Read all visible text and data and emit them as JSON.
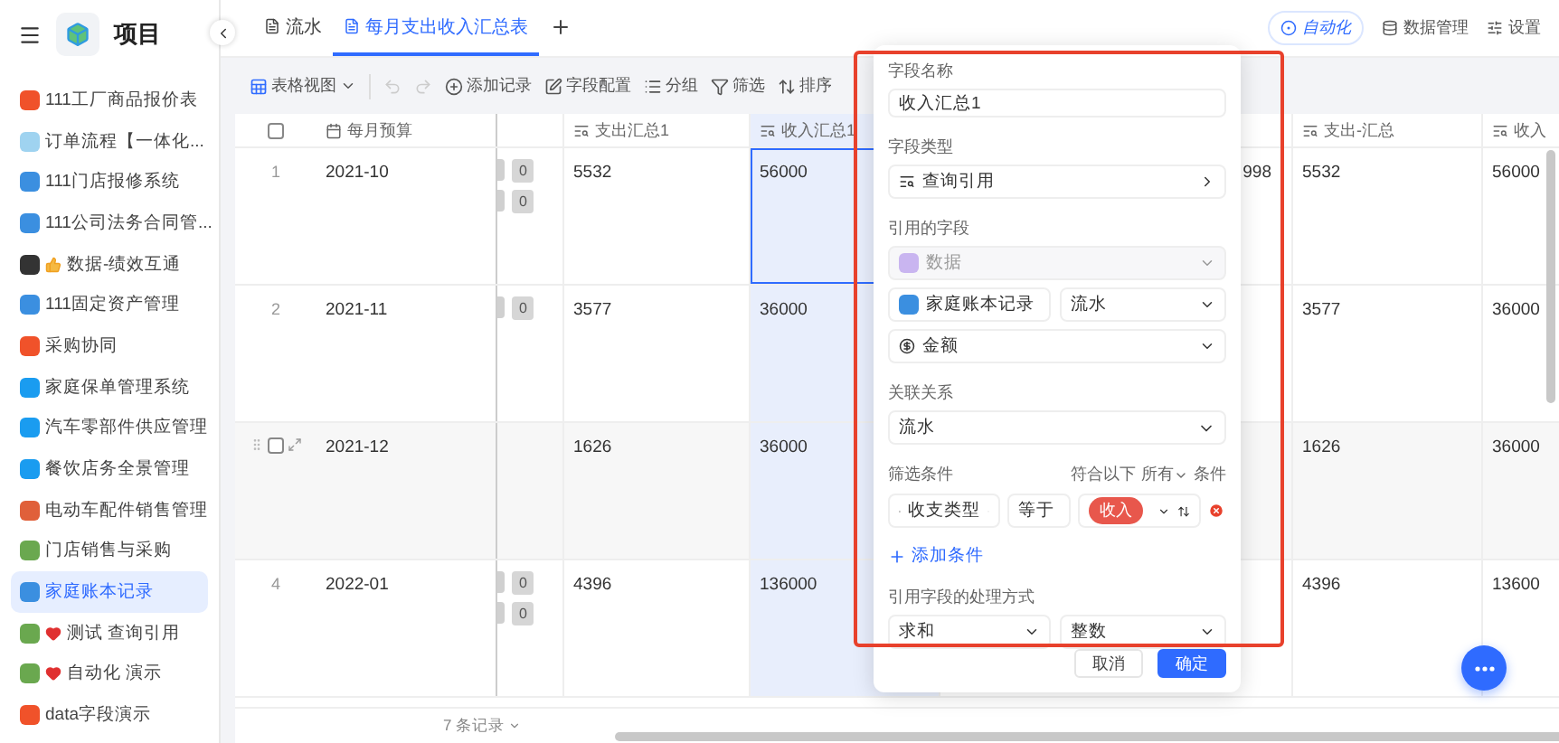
{
  "sidebar": {
    "title": "项目",
    "items": [
      {
        "label": "111工厂商品报价表",
        "color": "#f0522a",
        "selected": false
      },
      {
        "label": "订单流程【一体化...",
        "color": "#9fd3f0",
        "selected": false
      },
      {
        "label": "111门店报修系统",
        "color": "#3b8fe0",
        "selected": false
      },
      {
        "label": "111公司法务合同管...",
        "color": "#3b8fe0",
        "selected": false
      },
      {
        "label": "数据-绩效互通",
        "color": "#333333",
        "kind": "thumb",
        "selected": false
      },
      {
        "label": "111固定资产管理",
        "color": "#3b8fe0",
        "selected": false
      },
      {
        "label": "采购协同",
        "color": "#f0522a",
        "selected": false
      },
      {
        "label": "家庭保单管理系统",
        "color": "#1a9cf0",
        "selected": false
      },
      {
        "label": "汽车零部件供应管理",
        "color": "#1a9cf0",
        "selected": false
      },
      {
        "label": "餐饮店务全景管理",
        "color": "#1a9cf0",
        "selected": false
      },
      {
        "label": "电动车配件销售管理",
        "color": "#e0603a",
        "selected": false
      },
      {
        "label": "门店销售与采购",
        "color": "#6aa84f",
        "selected": false
      },
      {
        "label": "家庭账本记录",
        "color": "#3b8fe0",
        "selected": true
      },
      {
        "label": "测试 查询引用",
        "color": "#6aa84f",
        "kind": "heart",
        "selected": false
      },
      {
        "label": "自动化 演示",
        "color": "#6aa84f",
        "kind": "heart",
        "selected": false
      },
      {
        "label": "data字段演示",
        "color": "#f0522a",
        "selected": false
      }
    ]
  },
  "tabs": [
    {
      "label": "流水",
      "selected": false
    },
    {
      "label": "每月支出收入汇总表",
      "selected": true
    }
  ],
  "top_actions": {
    "automation": "自动化",
    "data_manage": "数据管理",
    "settings": "设置"
  },
  "toolbar": {
    "view": "表格视图",
    "items": [
      "添加记录",
      "字段配置",
      "分组",
      "筛选",
      "排序"
    ]
  },
  "table": {
    "columns": [
      {
        "label": "每月预算",
        "kind": "date",
        "selected": false
      },
      {
        "label": "支出汇总1",
        "kind": "lookup",
        "selected": false
      },
      {
        "label": "收入汇总1",
        "kind": "lookup",
        "selected": true
      },
      {
        "label": "支出-汇总",
        "kind": "lookup",
        "selected": false
      },
      {
        "label": "收入",
        "kind": "lookup",
        "selected": false
      }
    ],
    "rows": [
      {
        "number": "1",
        "hovered": false,
        "active": true,
        "month": "2021-10",
        "tags": [
          "0",
          "0"
        ],
        "expense": "5532",
        "income": "56000",
        "covered_value": "998",
        "expense_2": "5532",
        "income_2": "56000"
      },
      {
        "number": "2",
        "hovered": false,
        "active": false,
        "month": "2021-11",
        "tags": [
          "0"
        ],
        "expense": "3577",
        "income": "36000",
        "expense_2": "3577",
        "income_2": "36000"
      },
      {
        "hovered": true,
        "checked": false,
        "active": false,
        "month": "2021-12",
        "tags": [],
        "expense": "1626",
        "income": "36000",
        "expense_2": "1626",
        "income_2": "36000"
      },
      {
        "number": "4",
        "hovered": false,
        "active": false,
        "month": "2022-01",
        "tags": [
          "0",
          "0"
        ],
        "expense": "4396",
        "income": "136000",
        "expense_2": "4396",
        "income_2": "13600"
      }
    ],
    "footer": "7 条记录",
    "all_checked": false
  },
  "panel": {
    "name_label": "字段名称",
    "name_value": "收入汇总1",
    "type_label": "字段类型",
    "type_value": "查询引用",
    "ref_label": "引用的字段",
    "ref_source": "数据",
    "ref_table": "家庭账本记录",
    "ref_view": "流水",
    "ref_field": "金额",
    "relation_label": "关联关系",
    "relation_value": "流水",
    "filter_label": "筛选条件",
    "match_prefix": "符合以下",
    "match_mode": "所有",
    "match_suffix": "条件",
    "condition": {
      "field": "收支类型",
      "operator": "等于",
      "value": "收入"
    },
    "add_condition": "添加条件",
    "process_label": "引用字段的处理方式",
    "process_value": "求和",
    "format_value": "整数",
    "cancel": "取消",
    "confirm": "确定"
  }
}
